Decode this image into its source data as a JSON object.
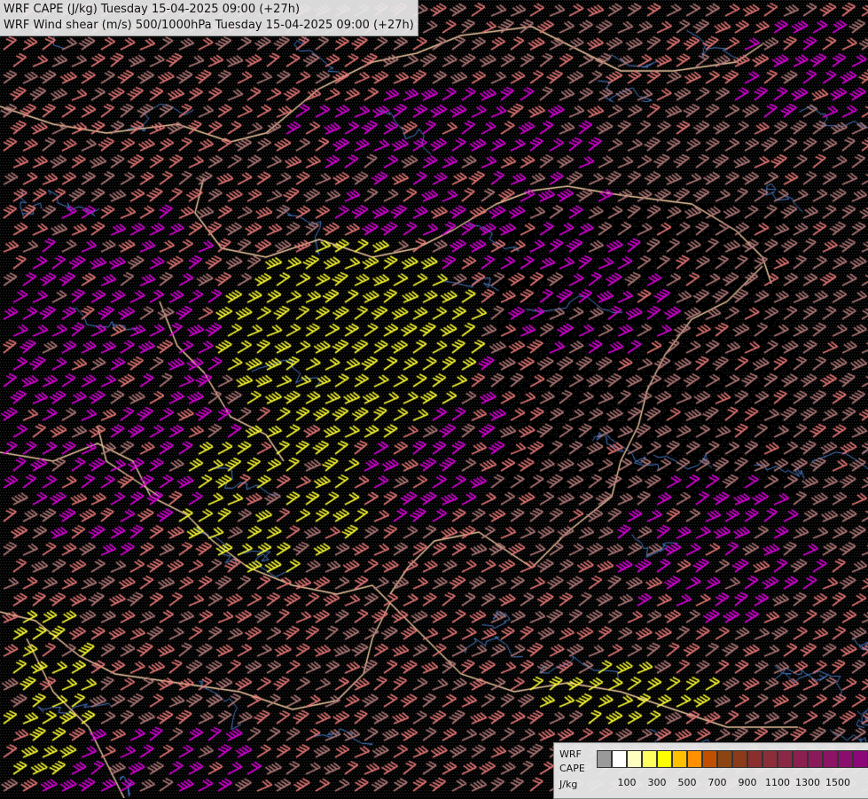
{
  "title": {
    "line1": "WRF CAPE (J/kg) Tuesday 15-04-2025 09:00 (+27h)",
    "line2": "WRF Wind shear (m/s) 500/1000hPa Tuesday 15-04-2025 09:00 (+27h)"
  },
  "legend": {
    "label_model": "WRF",
    "label_var": "CAPE",
    "label_unit": "J/kg",
    "colors": [
      "#9a9a9a",
      "#ffffff",
      "#ffffc0",
      "#ffff60",
      "#ffff00",
      "#ffc000",
      "#ff9000",
      "#c05000",
      "#8b4513",
      "#8b3a1a",
      "#8b2e2e",
      "#8b2e3a",
      "#8b2846",
      "#8b2050",
      "#8b1a5a",
      "#8b1464",
      "#8b0e6e",
      "#8b0878"
    ],
    "ticks": [
      "100",
      "300",
      "500",
      "700",
      "900",
      "1100",
      "1300",
      "1500"
    ]
  },
  "colors": {
    "background": "#000000",
    "barb_pink": "#e87878",
    "barb_magenta": "#e000e0",
    "barb_yellow": "#ffff33",
    "barb_gray": "#b47a7a",
    "border": "#f0c8a0",
    "river": "#4a7bc8"
  }
}
